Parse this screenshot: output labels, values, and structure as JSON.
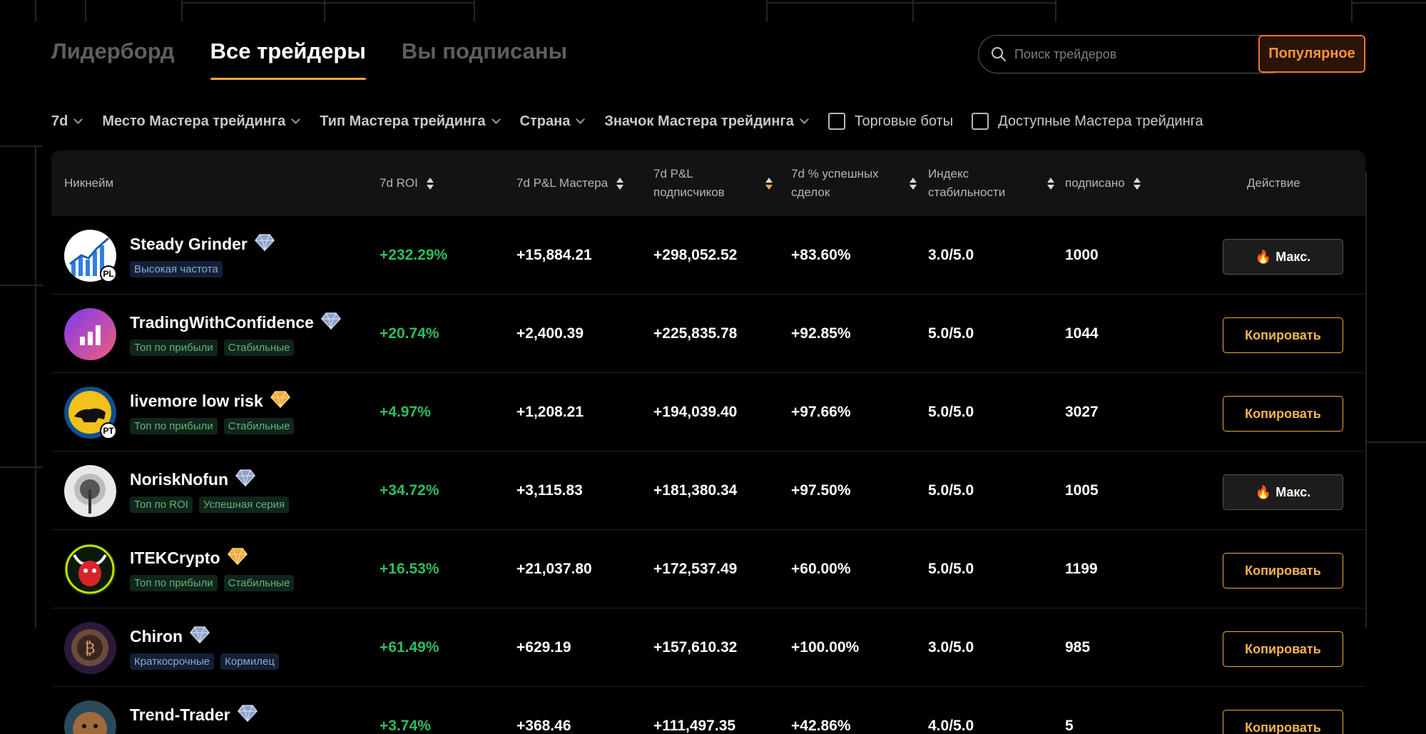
{
  "tabs": [
    {
      "label": "Лидерборд",
      "active": false
    },
    {
      "label": "Все трейдеры",
      "active": true
    },
    {
      "label": "Вы подписаны",
      "active": false
    }
  ],
  "search": {
    "placeholder": "Поиск трейдеров"
  },
  "popular_button": "Популярное",
  "filters": {
    "period": "7d",
    "place": "Место Мастера трейдинга",
    "type": "Тип Мастера трейдинга",
    "country": "Страна",
    "badge": "Значок Мастера трейдинга",
    "bots": "Торговые боты",
    "available": "Доступные Мастера трейдинга"
  },
  "columns": {
    "nickname": "Никнейм",
    "roi": "7d ROI",
    "pnl_master": "7d P&L Мастера",
    "pnl_followers": "7d P&L подписчиков",
    "win_rate": "7d % успешных сделок",
    "stability": "Индекс стабильности",
    "followers": "подписано",
    "action": "Действие"
  },
  "colors": {
    "accent": "#f0a93d",
    "positive": "#2ebd5f",
    "popular": "#f0722b"
  },
  "rows": [
    {
      "name": "Steady Grinder",
      "badge_icon": "diamond-icon",
      "tags": [
        {
          "text": "Высокая частота",
          "color": "blue"
        }
      ],
      "roi": "+232.29%",
      "pnl_master": "+15,884.21",
      "pnl_followers": "+298,052.52",
      "win_rate": "+83.60%",
      "stability": "3.0/5.0",
      "followers": "1000",
      "action": "Макс.",
      "action_type": "max",
      "avatar_badge": "PL"
    },
    {
      "name": "TradingWithConfidence",
      "badge_icon": "diamond-icon",
      "tags": [
        {
          "text": "Топ по прибыли",
          "color": "green"
        },
        {
          "text": "Стабильные",
          "color": "green"
        }
      ],
      "roi": "+20.74%",
      "pnl_master": "+2,400.39",
      "pnl_followers": "+225,835.78",
      "win_rate": "+92.85%",
      "stability": "5.0/5.0",
      "followers": "1044",
      "action": "Копировать",
      "action_type": "copy",
      "avatar_badge": ""
    },
    {
      "name": "livemore low risk",
      "badge_icon": "gold-badge-icon",
      "tags": [
        {
          "text": "Топ по прибыли",
          "color": "green"
        },
        {
          "text": "Стабильные",
          "color": "green"
        }
      ],
      "roi": "+4.97%",
      "pnl_master": "+1,208.21",
      "pnl_followers": "+194,039.40",
      "win_rate": "+97.66%",
      "stability": "5.0/5.0",
      "followers": "3027",
      "action": "Копировать",
      "action_type": "copy",
      "avatar_badge": "PT"
    },
    {
      "name": "NoriskNofun",
      "badge_icon": "diamond-icon",
      "tags": [
        {
          "text": "Топ по ROI",
          "color": "green"
        },
        {
          "text": "Успешная серия",
          "color": "green"
        }
      ],
      "roi": "+34.72%",
      "pnl_master": "+3,115.83",
      "pnl_followers": "+181,380.34",
      "win_rate": "+97.50%",
      "stability": "5.0/5.0",
      "followers": "1005",
      "action": "Макс.",
      "action_type": "max",
      "avatar_badge": ""
    },
    {
      "name": "ITEKCrypto",
      "badge_icon": "gold-badge-icon",
      "tags": [
        {
          "text": "Топ по прибыли",
          "color": "green"
        },
        {
          "text": "Стабильные",
          "color": "green"
        }
      ],
      "roi": "+16.53%",
      "pnl_master": "+21,037.80",
      "pnl_followers": "+172,537.49",
      "win_rate": "+60.00%",
      "stability": "5.0/5.0",
      "followers": "1199",
      "action": "Копировать",
      "action_type": "copy",
      "avatar_badge": ""
    },
    {
      "name": "Chiron",
      "badge_icon": "diamond-icon",
      "tags": [
        {
          "text": "Краткосрочные",
          "color": "blue"
        },
        {
          "text": "Кормилец",
          "color": "blue"
        }
      ],
      "roi": "+61.49%",
      "pnl_master": "+629.19",
      "pnl_followers": "+157,610.32",
      "win_rate": "+100.00%",
      "stability": "3.0/5.0",
      "followers": "985",
      "action": "Копировать",
      "action_type": "copy",
      "avatar_badge": ""
    },
    {
      "name": "Trend-Trader",
      "badge_icon": "diamond-icon",
      "tags": [],
      "roi": "+3.74%",
      "pnl_master": "+368.46",
      "pnl_followers": "+111,497.35",
      "win_rate": "+42.86%",
      "stability": "4.0/5.0",
      "followers": "5",
      "action": "Копировать",
      "action_type": "copy",
      "avatar_badge": ""
    }
  ]
}
